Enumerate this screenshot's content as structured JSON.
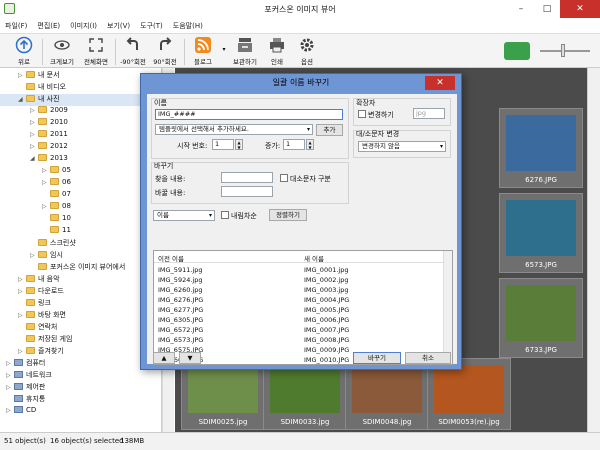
{
  "window": {
    "title": "포커스온 이미지 뷰어"
  },
  "menu": [
    "파일(F)",
    "편집(E)",
    "이미지(I)",
    "보기(V)",
    "도구(T)",
    "도움말(H)"
  ],
  "toolbar": {
    "up": "위로",
    "fit": "크게보기",
    "fullscreen": "전체화면",
    "rotate_left": "-90°회전",
    "rotate_right": "90°회전",
    "blog": "블로그",
    "save": "보관하기",
    "print": "인쇄",
    "options": "옵션"
  },
  "tree": [
    {
      "label": "내 문서",
      "indent": 1,
      "arrow": "▷",
      "type": "folder"
    },
    {
      "label": "내 비디오",
      "indent": 1,
      "arrow": "",
      "type": "folder"
    },
    {
      "label": "내 사진",
      "indent": 1,
      "arrow": "◢",
      "type": "folder",
      "selected": true
    },
    {
      "label": "2009",
      "indent": 2,
      "arrow": "▷",
      "type": "folder"
    },
    {
      "label": "2010",
      "indent": 2,
      "arrow": "▷",
      "type": "folder"
    },
    {
      "label": "2011",
      "indent": 2,
      "arrow": "▷",
      "type": "folder"
    },
    {
      "label": "2012",
      "indent": 2,
      "arrow": "▷",
      "type": "folder"
    },
    {
      "label": "2013",
      "indent": 2,
      "arrow": "◢",
      "type": "folder"
    },
    {
      "label": "05",
      "indent": 3,
      "arrow": "▷",
      "type": "folder"
    },
    {
      "label": "06",
      "indent": 3,
      "arrow": "▷",
      "type": "folder"
    },
    {
      "label": "07",
      "indent": 3,
      "arrow": "",
      "type": "folder"
    },
    {
      "label": "08",
      "indent": 3,
      "arrow": "▷",
      "type": "folder"
    },
    {
      "label": "10",
      "indent": 3,
      "arrow": "",
      "type": "folder"
    },
    {
      "label": "11",
      "indent": 3,
      "arrow": "",
      "type": "folder"
    },
    {
      "label": "스크린샷",
      "indent": 2,
      "arrow": "",
      "type": "folder"
    },
    {
      "label": "임시",
      "indent": 2,
      "arrow": "▷",
      "type": "folder"
    },
    {
      "label": "포커스온 이미지 뷰어에서",
      "indent": 2,
      "arrow": "",
      "type": "folder"
    },
    {
      "label": "내 음악",
      "indent": 1,
      "arrow": "▷",
      "type": "folder"
    },
    {
      "label": "다운로드",
      "indent": 1,
      "arrow": "▷",
      "type": "folder"
    },
    {
      "label": "링크",
      "indent": 1,
      "arrow": "",
      "type": "folder"
    },
    {
      "label": "바탕 화면",
      "indent": 1,
      "arrow": "▷",
      "type": "folder"
    },
    {
      "label": "연락처",
      "indent": 1,
      "arrow": "",
      "type": "folder"
    },
    {
      "label": "저장된 게임",
      "indent": 1,
      "arrow": "",
      "type": "folder"
    },
    {
      "label": "즐겨찾기",
      "indent": 1,
      "arrow": "▷",
      "type": "folder"
    },
    {
      "label": "컴퓨터",
      "indent": 0,
      "arrow": "▷",
      "type": "drive"
    },
    {
      "label": "네트워크",
      "indent": 0,
      "arrow": "▷",
      "type": "drive"
    },
    {
      "label": "제어판",
      "indent": 0,
      "arrow": "▷",
      "type": "drive"
    },
    {
      "label": "휴지통",
      "indent": 0,
      "arrow": "",
      "type": "drive"
    },
    {
      "label": "CD",
      "indent": 0,
      "arrow": "▷",
      "type": "drive"
    }
  ],
  "thumbnails": [
    {
      "caption": "6276.JPG",
      "color": "#3b6a9e"
    },
    {
      "caption": "6573.JPG",
      "color": "#2f6f8e"
    },
    {
      "caption": "6733.JPG",
      "color": "#5b7d3a"
    },
    {
      "caption": "SDIM0025.jpg",
      "color": "#6e8f4a"
    },
    {
      "caption": "SDIM0033.jpg",
      "color": "#4f7b2e"
    },
    {
      "caption": "SDIM0048.jpg",
      "color": "#8a5a3a"
    },
    {
      "caption": "SDIM0053(re).jpg",
      "color": "#b4561f"
    }
  ],
  "status": {
    "objects": "51 object(s)",
    "selected": "16 object(s) selected",
    "size": "138MB"
  },
  "dialog": {
    "title": "일괄 이름 바꾸기",
    "name_label": "이름",
    "name_value": "IMG_####",
    "template_combo": "템플릿에서 선택해서 추가하세요.",
    "add_button": "추가",
    "start_label": "시작 번호:",
    "start_value": "1",
    "step_label": "증가:",
    "step_value": "1",
    "ext_label": "확장자",
    "ext_change": "변경하기",
    "ext_value": "jpg",
    "case_label": "대/소문자 변경",
    "case_combo": "변경하지 않음",
    "replace_label": "바꾸기",
    "find_label": "찾을 내용:",
    "replace_with_label": "바꿀 내용:",
    "case_sensitive": "대소문자 구분",
    "sort_combo": "이름",
    "descending": "내림차순",
    "sort_button": "정렬하기",
    "col_old": "이전 이름",
    "col_new": "새 이름",
    "rows": [
      [
        "IMG_5911.jpg",
        "IMG_0001.jpg"
      ],
      [
        "IMG_5924.jpg",
        "IMG_0002.jpg"
      ],
      [
        "IMG_6260.jpg",
        "IMG_0003.jpg"
      ],
      [
        "IMG_6276.JPG",
        "IMG_0004.JPG"
      ],
      [
        "IMG_6277.JPG",
        "IMG_0005.JPG"
      ],
      [
        "IMG_6305.JPG",
        "IMG_0006.JPG"
      ],
      [
        "IMG_6572.JPG",
        "IMG_0007.JPG"
      ],
      [
        "IMG_6573.JPG",
        "IMG_0008.JPG"
      ],
      [
        "IMG_6575.JPG",
        "IMG_0009.JPG"
      ],
      [
        "IMG_6694.JPG",
        "IMG_0010.JPG"
      ]
    ],
    "up": "▲",
    "down": "▼",
    "ok": "바꾸기",
    "cancel": "취소"
  }
}
